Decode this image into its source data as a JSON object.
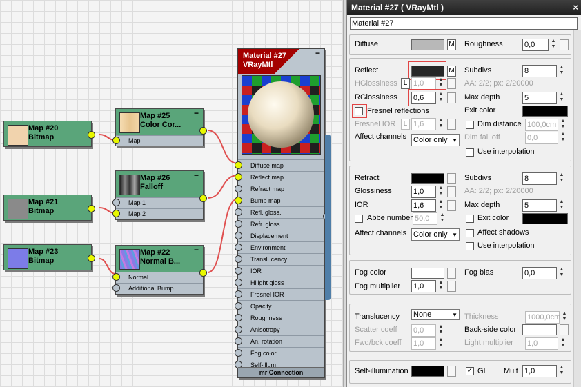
{
  "graph": {
    "nodes": {
      "map20": {
        "name": "Map #20",
        "type": "Bitmap",
        "thumb_color": "#f1d3ad"
      },
      "map21": {
        "name": "Map #21",
        "type": "Bitmap",
        "thumb_color": "#8a8a8a"
      },
      "map23": {
        "name": "Map #23",
        "type": "Bitmap",
        "thumb_color": "#7c7ce8"
      },
      "map25": {
        "name": "Map #25",
        "type": "Color Cor...",
        "slots": [
          "Map"
        ]
      },
      "map26": {
        "name": "Map #26",
        "type": "Falloff",
        "slots": [
          "Map 1",
          "Map 2"
        ]
      },
      "map22": {
        "name": "Map #22",
        "type": "Normal B...",
        "slots": [
          "Normal",
          "Additional Bump"
        ]
      }
    },
    "material_node": {
      "name": "Material #27",
      "type": "VRayMtl",
      "header_color": "#a40000",
      "slots": [
        "Diffuse map",
        "Reflect map",
        "Refract map",
        "Bump map",
        "Refl. gloss.",
        "Refr. gloss.",
        "Displacement",
        "Environment",
        "Translucency",
        "IOR",
        "Hilight gloss",
        "Fresnel IOR",
        "Opacity",
        "Roughness",
        "Anisotropy",
        "An. rotation",
        "Fog color",
        "Self-illum"
      ],
      "footer": "mr Connection"
    }
  },
  "panel": {
    "title": "Material #27  ( VRayMtl )",
    "name_value": "Material #27",
    "basic": {
      "diffuse_label": "Diffuse",
      "diffuse_color": "#b8b8b8",
      "m_label": "M",
      "roughness_label": "Roughness",
      "roughness_value": "0,0"
    },
    "reflection": {
      "reflect_label": "Reflect",
      "reflect_color": "#262626",
      "m_label": "M",
      "subdivs_label": "Subdivs",
      "subdivs_value": "8",
      "hglossiness_label": "HGlossiness",
      "l_label": "L",
      "hglossiness_value": "1,0",
      "aa_info": "AA: 2/2; px: 2/20000",
      "rglossiness_label": "RGlossiness",
      "rglossiness_value": "0,6",
      "max_depth_label": "Max depth",
      "max_depth_value": "5",
      "fresnel_label": "Fresnel reflections",
      "exit_color_label": "Exit color",
      "exit_color": "#000000",
      "fresnel_ior_label": "Fresnel IOR",
      "fresnel_ior_value": "1,6",
      "dim_distance_label": "Dim distance",
      "dim_distance_value": "100,0cm",
      "affect_channels_label": "Affect channels",
      "affect_channels_value": "Color only",
      "dim_falloff_label": "Dim fall off",
      "dim_falloff_value": "0,0",
      "use_interp_label": "Use interpolation"
    },
    "refraction": {
      "refract_label": "Refract",
      "refract_color": "#000000",
      "subdivs_label": "Subdivs",
      "subdivs_value": "8",
      "glossiness_label": "Glossiness",
      "glossiness_value": "1,0",
      "aa_info": "AA: 2/2; px: 2/20000",
      "ior_label": "IOR",
      "ior_value": "1,6",
      "max_depth_label": "Max depth",
      "max_depth_value": "5",
      "abbe_label": "Abbe number",
      "abbe_value": "50,0",
      "exit_color_label": "Exit color",
      "exit_color": "#000000",
      "affect_channels_label": "Affect channels",
      "affect_channels_value": "Color only",
      "affect_shadows_label": "Affect shadows",
      "use_interp_label": "Use interpolation"
    },
    "fog": {
      "fog_color_label": "Fog color",
      "fog_color": "#ffffff",
      "fog_bias_label": "Fog bias",
      "fog_bias_value": "0,0",
      "fog_multiplier_label": "Fog multiplier",
      "fog_multiplier_value": "1,0"
    },
    "translucency": {
      "translucency_label": "Translucency",
      "translucency_value": "None",
      "thickness_label": "Thickness",
      "thickness_value": "1000,0cm",
      "scatter_label": "Scatter coeff",
      "scatter_value": "0,0",
      "backside_label": "Back-side color",
      "backside_color": "#ffffff",
      "fwdbck_label": "Fwd/bck coeff",
      "fwdbck_value": "1,0",
      "light_mult_label": "Light multiplier",
      "light_mult_value": "1,0"
    },
    "selfillum": {
      "label": "Self-illumination",
      "color": "#000000",
      "gi_label": "GI",
      "mult_label": "Mult",
      "mult_value": "1,0"
    }
  }
}
